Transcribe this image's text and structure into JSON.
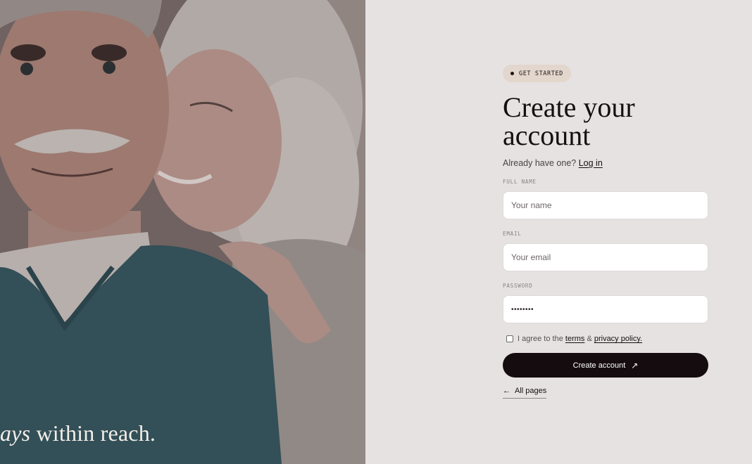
{
  "hero": {
    "tagline_lead": "ays",
    "tagline_rest": " within reach."
  },
  "badge": {
    "label": "GET STARTED"
  },
  "heading": {
    "title": "Create your account"
  },
  "login_prompt": {
    "text": "Already have one? ",
    "link_label": "Log in"
  },
  "form": {
    "full_name": {
      "label": "FULL NAME",
      "placeholder": "Your name"
    },
    "email": {
      "label": "EMAIL",
      "placeholder": "Your email"
    },
    "password": {
      "label": "PASSWORD",
      "value": "••••••••"
    },
    "agree": {
      "prefix": "I agree to the ",
      "terms_link": "terms",
      "connector": " & ",
      "privacy_link": "privacy policy."
    },
    "submit_label": "Create account",
    "submit_icon": "↗"
  },
  "back_link": {
    "icon": "←",
    "label": "All pages"
  },
  "colors": {
    "panel_bg": "#e6e2e2",
    "badge_bg": "#e3d6cc",
    "cta_bg": "#150c0f"
  }
}
